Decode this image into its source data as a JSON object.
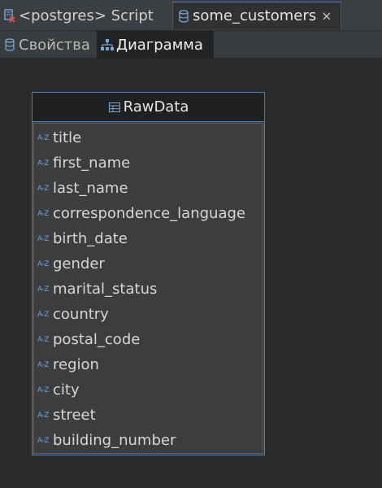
{
  "editor_tabs": [
    {
      "label": "<postgres> Script",
      "icon": "sql-script-error-icon"
    },
    {
      "label": "some_customers",
      "icon": "database-icon",
      "close": "×"
    }
  ],
  "sub_tabs": [
    {
      "label": "Свойства",
      "icon": "database-icon"
    },
    {
      "label": "Диаграмма",
      "icon": "diagram-icon"
    }
  ],
  "entity": {
    "name": "RawData",
    "attr_icon_text": "A-Z",
    "attributes": [
      "title",
      "first_name",
      "last_name",
      "correspondence_language",
      "birth_date",
      "gender",
      "marital_status",
      "country",
      "postal_code",
      "region",
      "city",
      "street",
      "building_number"
    ]
  },
  "colors": {
    "accent": "#3f7fc7",
    "attr_icon": "#6aa6e6",
    "background": "#2b2b2b"
  }
}
